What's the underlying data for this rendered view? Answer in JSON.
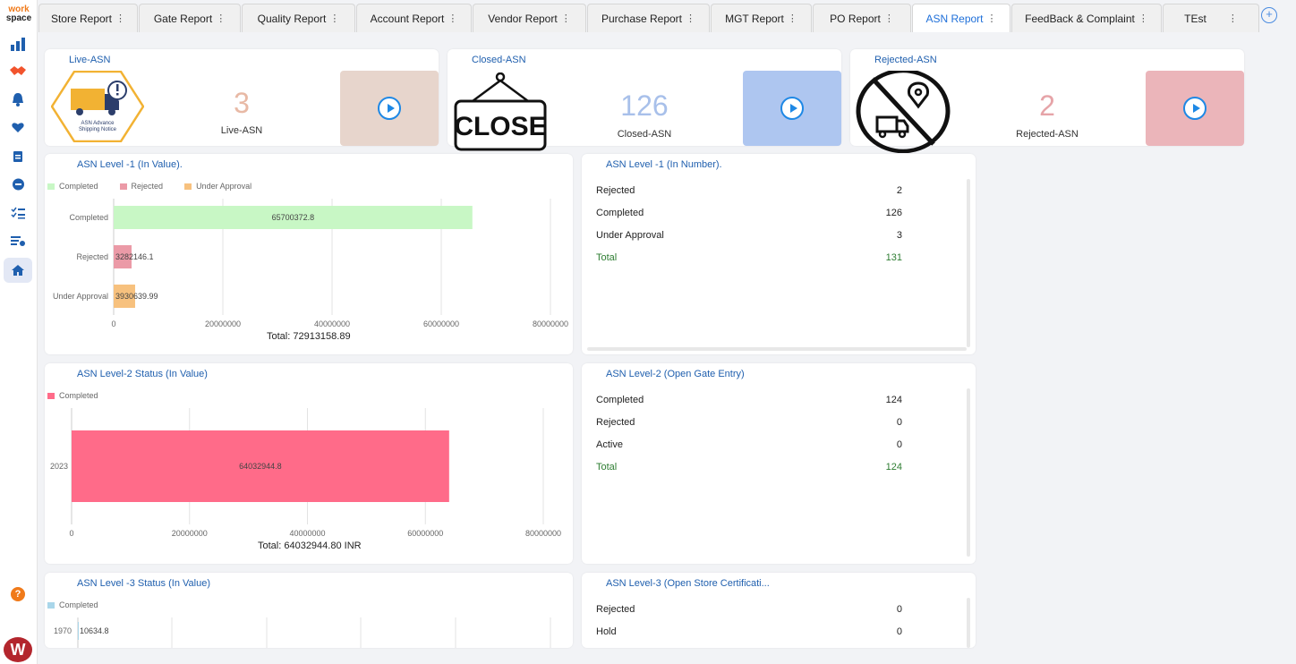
{
  "sidebar": {
    "logo_line1": "work",
    "logo_line2": "space",
    "items": [
      "bar-chart",
      "handshake",
      "bell",
      "heart",
      "clipboard",
      "chat",
      "checklist",
      "bulk-edit",
      "home"
    ],
    "avatar": "W"
  },
  "tabs": [
    {
      "label": "Store Report"
    },
    {
      "label": "Gate Report"
    },
    {
      "label": "Quality Report"
    },
    {
      "label": "Account Report"
    },
    {
      "label": "Vendor Report"
    },
    {
      "label": "Purchase Report"
    },
    {
      "label": "MGT Report"
    },
    {
      "label": "PO Report"
    },
    {
      "label": "ASN Report",
      "active": true
    },
    {
      "label": "FeedBack & Complaint"
    },
    {
      "label": "TEst"
    }
  ],
  "kpis": [
    {
      "title": "Live-ASN",
      "value": "3",
      "label": "Live-ASN",
      "value_color": "#e8b9a5",
      "box_color": "#e7d5cc",
      "badge_line1": "ASN Advance",
      "badge_line2": "Shipping Notice"
    },
    {
      "title": "Closed-ASN",
      "value": "126",
      "label": "Closed-ASN",
      "value_color": "#a8c0ea",
      "box_color": "#aec6f0",
      "sign_text": "CLOSE"
    },
    {
      "title": "Rejected-ASN",
      "value": "2",
      "label": "Rejected-ASN",
      "value_color": "#e6a4a8",
      "box_color": "#ebb5ba"
    }
  ],
  "charts": {
    "level1_value": {
      "title": "ASN Level -1 (In Value).",
      "legend": [
        "Completed",
        "Rejected",
        "Under Approval"
      ],
      "total": "Total: 72913158.89"
    },
    "level2_value": {
      "title": "ASN Level-2 Status (In Value)",
      "legend": [
        "Completed"
      ],
      "total": "Total: 64032944.80 INR"
    },
    "level3_value": {
      "title": "ASN Level -3 Status (In Value)",
      "legend": [
        "Completed"
      ]
    }
  },
  "chart_data": [
    {
      "type": "bar",
      "orientation": "horizontal",
      "categories": [
        "Completed",
        "Rejected",
        "Under Approval"
      ],
      "values": [
        65700372.8,
        3282146.1,
        3930639.99
      ],
      "value_labels": [
        "65700372.8",
        "3282146.1",
        "3930639.99"
      ],
      "colors": [
        "#c8f7c5",
        "#eb9aa7",
        "#f7c17e"
      ],
      "xticks": [
        "0",
        "20000000",
        "40000000",
        "60000000",
        "80000000"
      ],
      "xlim": [
        0,
        80000000
      ],
      "legend": "top-left",
      "grid": true
    },
    {
      "type": "bar",
      "orientation": "horizontal",
      "categories": [
        "2023"
      ],
      "values": [
        64032944.8
      ],
      "value_labels": [
        "64032944.8"
      ],
      "colors": [
        "#ff6b89"
      ],
      "xticks": [
        "0",
        "20000000",
        "40000000",
        "60000000",
        "80000000"
      ],
      "xlim": [
        0,
        80000000
      ],
      "legend": "top-left",
      "grid": true
    },
    {
      "type": "bar",
      "orientation": "horizontal",
      "categories": [
        "1970"
      ],
      "values": [
        10634.8
      ],
      "value_labels": [
        "10634.8"
      ],
      "colors": [
        "#a9d6ea"
      ],
      "legend": "top-left",
      "grid": true
    }
  ],
  "tables": {
    "level1_number": {
      "title": "ASN Level -1 (In Number).",
      "rows": [
        {
          "label": "Rejected",
          "value": "2"
        },
        {
          "label": "Completed",
          "value": "126"
        },
        {
          "label": "Under Approval",
          "value": "3"
        },
        {
          "label": "Total",
          "value": "131"
        }
      ]
    },
    "level2_gate": {
      "title": "ASN Level-2 (Open Gate Entry)",
      "rows": [
        {
          "label": "Completed",
          "value": "124"
        },
        {
          "label": "Rejected",
          "value": "0"
        },
        {
          "label": "Active",
          "value": "0"
        },
        {
          "label": "Total",
          "value": "124"
        }
      ]
    },
    "level3_store": {
      "title": "ASN Level-3 (Open Store Certificati...",
      "rows": [
        {
          "label": "Rejected",
          "value": "0"
        },
        {
          "label": "Hold",
          "value": "0"
        }
      ]
    }
  }
}
